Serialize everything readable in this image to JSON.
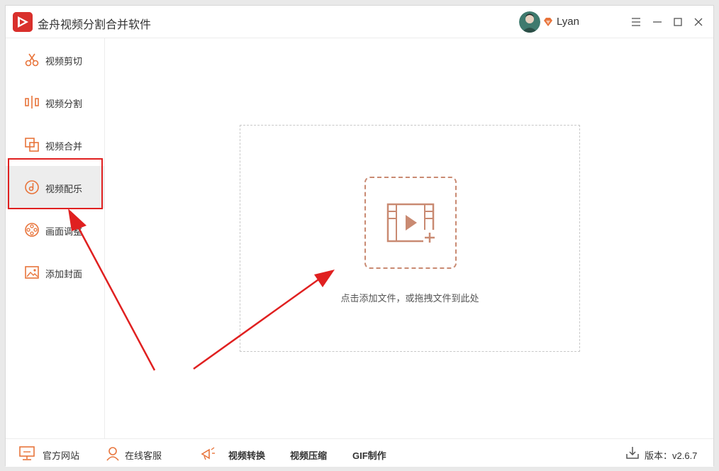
{
  "app": {
    "title": "金舟视频分割合并软件"
  },
  "user": {
    "name": "Lyan"
  },
  "sidebar": {
    "items": [
      {
        "label": "视频剪切",
        "icon": "scissors-icon"
      },
      {
        "label": "视频分割",
        "icon": "split-icon"
      },
      {
        "label": "视频合并",
        "icon": "merge-icon"
      },
      {
        "label": "视频配乐",
        "icon": "music-icon",
        "active": true
      },
      {
        "label": "画面调整",
        "icon": "film-reel-icon"
      },
      {
        "label": "添加封面",
        "icon": "image-icon"
      }
    ]
  },
  "main": {
    "drop_hint": "点击添加文件，或拖拽文件到此处"
  },
  "footer": {
    "official_site": "官方网站",
    "online_service": "在线客服",
    "convert": "视频转换",
    "compress": "视频压缩",
    "gif": "GIF制作",
    "version": "版本：v2.6.7"
  },
  "colors": {
    "accent": "#e8743b",
    "brand_red": "#d9302c",
    "annotation_red": "#e02020",
    "dropzone_border": "#c98a72"
  }
}
